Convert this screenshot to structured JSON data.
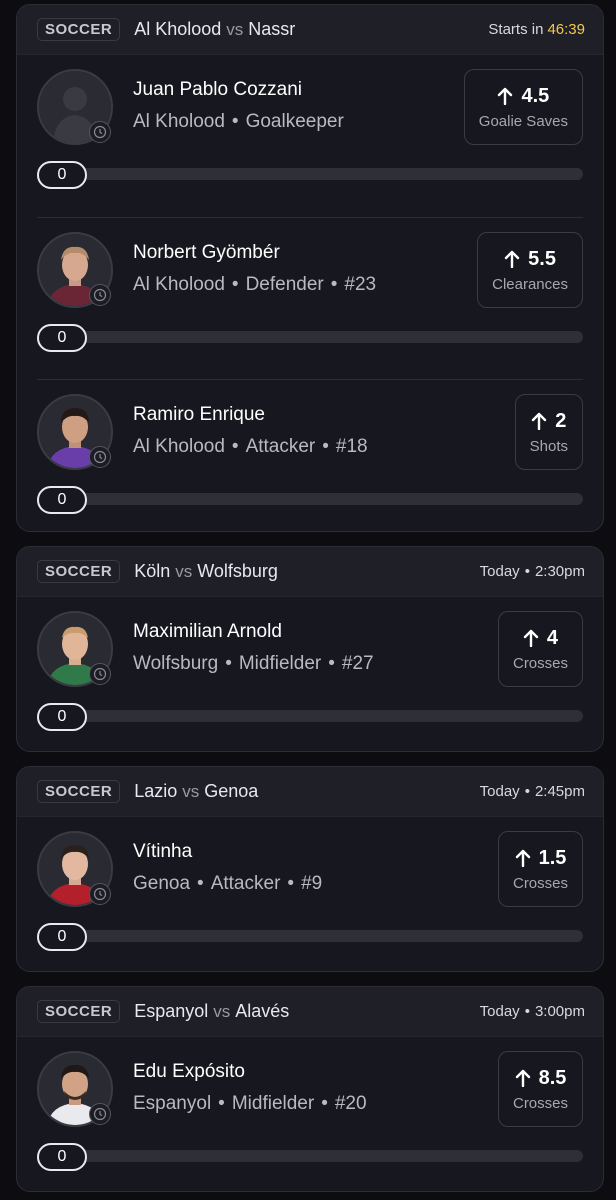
{
  "colors": {
    "accent_time": "#f2c94c",
    "card_bg": "#17171f",
    "header_bg": "#1f1f28"
  },
  "cards": [
    {
      "sport": "SOCCER",
      "home": "Al Kholood",
      "vs": "vs",
      "away": "Nassr",
      "time_prefix": "Starts in",
      "time_value": "46:39",
      "players": [
        {
          "name": "Juan Pablo Cozzani",
          "team": "Al Kholood",
          "position": "Goalkeeper",
          "number": "",
          "line": "4.5",
          "stat": "Goalie Saves",
          "progress": "0",
          "avatar": "silhouette"
        },
        {
          "name": "Norbert Gyömbér",
          "team": "Al Kholood",
          "position": "Defender",
          "number": "#23",
          "line": "5.5",
          "stat": "Clearances",
          "progress": "0",
          "avatar": "photo"
        },
        {
          "name": "Ramiro Enrique",
          "team": "Al Kholood",
          "position": "Attacker",
          "number": "#18",
          "line": "2",
          "stat": "Shots",
          "progress": "0",
          "avatar": "photo"
        }
      ]
    },
    {
      "sport": "SOCCER",
      "home": "Köln",
      "vs": "vs",
      "away": "Wolfsburg",
      "time_day": "Today",
      "time_value": "2:30pm",
      "players": [
        {
          "name": "Maximilian Arnold",
          "team": "Wolfsburg",
          "position": "Midfielder",
          "number": "#27",
          "line": "4",
          "stat": "Crosses",
          "progress": "0",
          "avatar": "photo"
        }
      ]
    },
    {
      "sport": "SOCCER",
      "home": "Lazio",
      "vs": "vs",
      "away": "Genoa",
      "time_day": "Today",
      "time_value": "2:45pm",
      "players": [
        {
          "name": "Vítinha",
          "team": "Genoa",
          "position": "Attacker",
          "number": "#9",
          "line": "1.5",
          "stat": "Crosses",
          "progress": "0",
          "avatar": "photo"
        }
      ]
    },
    {
      "sport": "SOCCER",
      "home": "Espanyol",
      "vs": "vs",
      "away": "Alavés",
      "time_day": "Today",
      "time_value": "3:00pm",
      "players": [
        {
          "name": "Edu Expósito",
          "team": "Espanyol",
          "position": "Midfielder",
          "number": "#20",
          "line": "8.5",
          "stat": "Crosses",
          "progress": "0",
          "avatar": "photo"
        }
      ]
    }
  ]
}
